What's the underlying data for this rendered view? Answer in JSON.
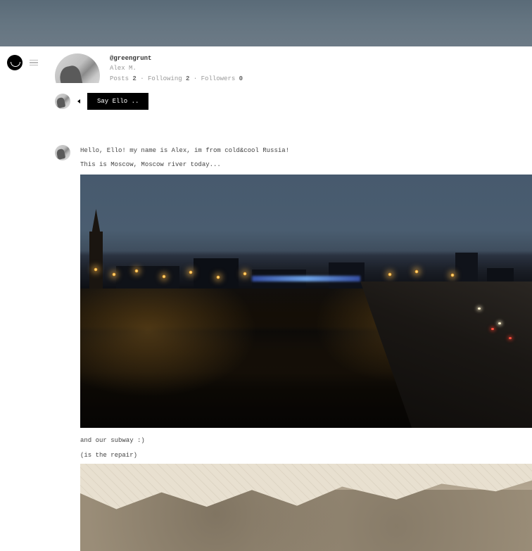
{
  "profile": {
    "handle": "@greengrunt",
    "display_name": "Alex M.",
    "stats": {
      "posts_label": "Posts",
      "posts_count": "2",
      "following_label": "Following",
      "following_count": "2",
      "followers_label": "Followers",
      "followers_count": "0"
    }
  },
  "compose": {
    "button_label": "Say Ello .."
  },
  "post": {
    "line1": "Hello, Ello! my name is Alex, im from cold&cool Russia!",
    "line2": "This is Moscow, Moscow river today...",
    "line3": "and our subway :)",
    "line4": "(is the repair)"
  }
}
